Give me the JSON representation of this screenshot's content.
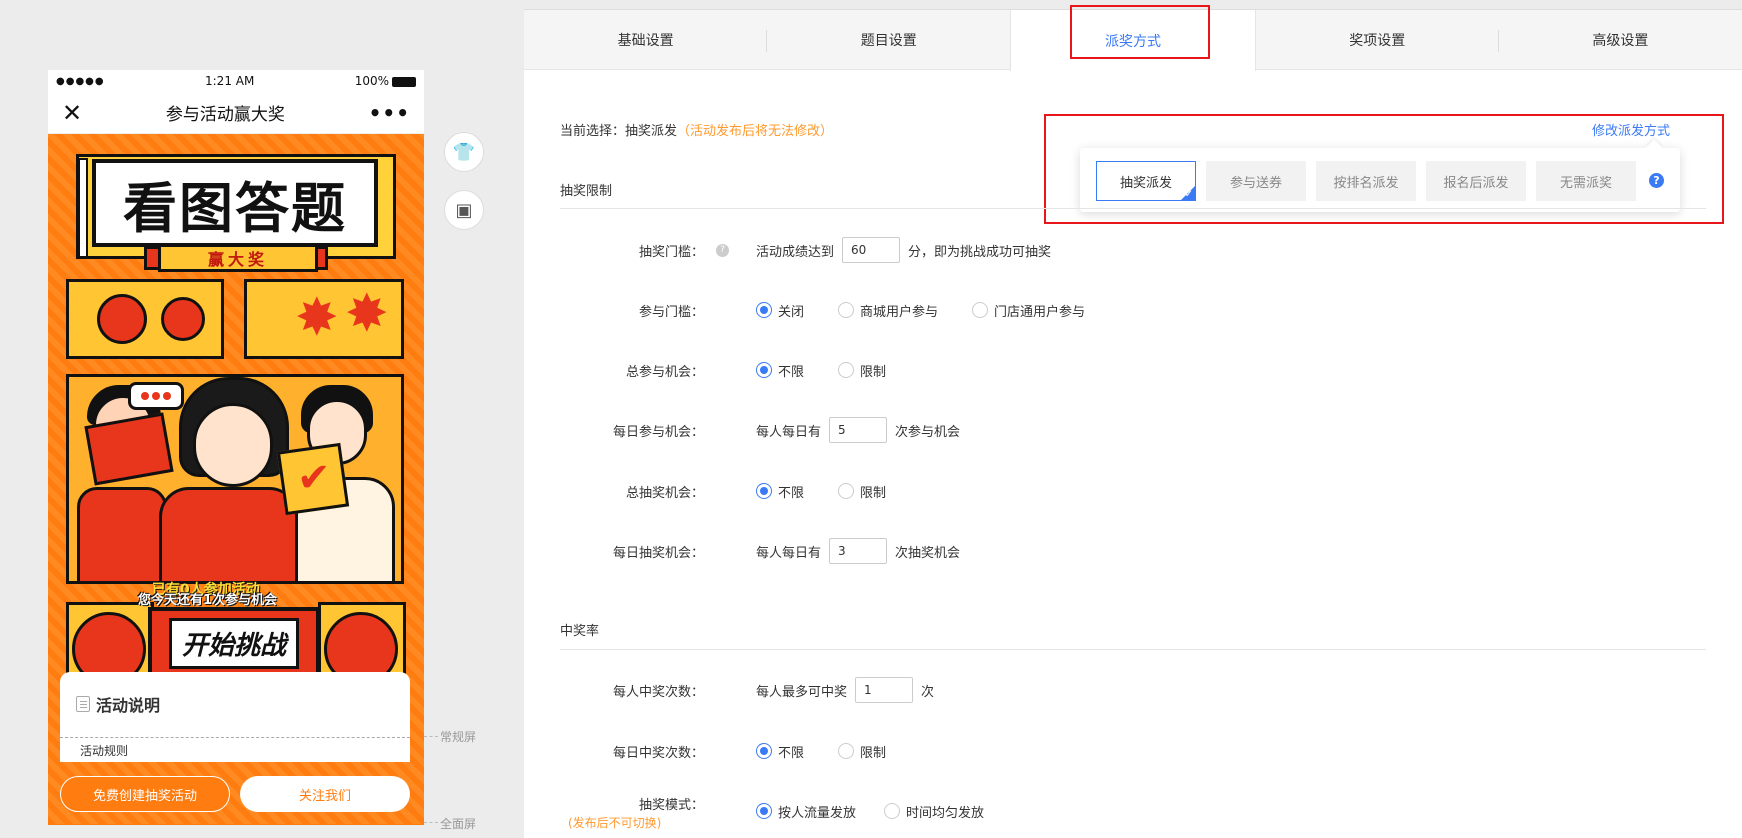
{
  "preview": {
    "status_time": "1:21 AM",
    "status_battery": "100%",
    "nav_title": "参与活动赢大奖",
    "poster_title": "看图答题",
    "poster_subtitle": "赢大奖",
    "participants_text": "已有0人参加活动",
    "chances_text": "您今天还有1次参与机会",
    "start_button": "开始挑战",
    "desc_title": "活动说明",
    "desc_rule": "活动规则",
    "free_create_button": "免费创建抽奖活动",
    "follow_button": "关注我们",
    "normal_screen_label": "常规屏",
    "full_screen_label": "全面屏"
  },
  "tabs": [
    {
      "label": "基础设置",
      "active": false
    },
    {
      "label": "题目设置",
      "active": false
    },
    {
      "label": "派奖方式",
      "active": true
    },
    {
      "label": "奖项设置",
      "active": false
    },
    {
      "label": "高级设置",
      "active": false
    }
  ],
  "current": {
    "prefix": "当前选择：",
    "value": "抽奖派发",
    "note": "（活动发布后将无法修改）",
    "modify_link": "修改派发方式"
  },
  "dispatch_options": [
    {
      "label": "抽奖派发",
      "selected": true
    },
    {
      "label": "参与送券",
      "selected": false
    },
    {
      "label": "按排名派发",
      "selected": false
    },
    {
      "label": "报名后派发",
      "selected": false
    },
    {
      "label": "无需派奖",
      "selected": false
    }
  ],
  "sections": {
    "limit_title": "抽奖限制",
    "rate_title": "中奖率"
  },
  "rows": {
    "threshold": {
      "label": "抽奖门槛：",
      "prefix": "活动成绩达到",
      "value": "60",
      "suffix": "分，即为挑战成功可抽奖"
    },
    "join_threshold": {
      "label": "参与门槛：",
      "options": [
        "关闭",
        "商城用户参与",
        "门店通用户参与"
      ]
    },
    "total_join": {
      "label": "总参与机会：",
      "options": [
        "不限",
        "限制"
      ]
    },
    "daily_join": {
      "label": "每日参与机会：",
      "prefix": "每人每日有",
      "value": "5",
      "suffix": "次参与机会"
    },
    "total_draw": {
      "label": "总抽奖机会：",
      "options": [
        "不限",
        "限制"
      ]
    },
    "daily_draw": {
      "label": "每日抽奖机会：",
      "prefix": "每人每日有",
      "value": "3",
      "suffix": "次抽奖机会"
    },
    "win_times": {
      "label": "每人中奖次数：",
      "prefix": "每人最多可中奖",
      "value": "1",
      "suffix": "次"
    },
    "daily_win": {
      "label": "每日中奖次数：",
      "options": [
        "不限",
        "限制"
      ]
    },
    "draw_mode": {
      "label": "抽奖模式：",
      "note": "(发布后不可切换)",
      "options": [
        "按人流量发放",
        "时间均匀发放"
      ]
    }
  },
  "colors": {
    "accent": "#3a7af5",
    "warning": "#ff9a2e",
    "highlight": "#e8161b",
    "poster": "#ff7d10"
  }
}
